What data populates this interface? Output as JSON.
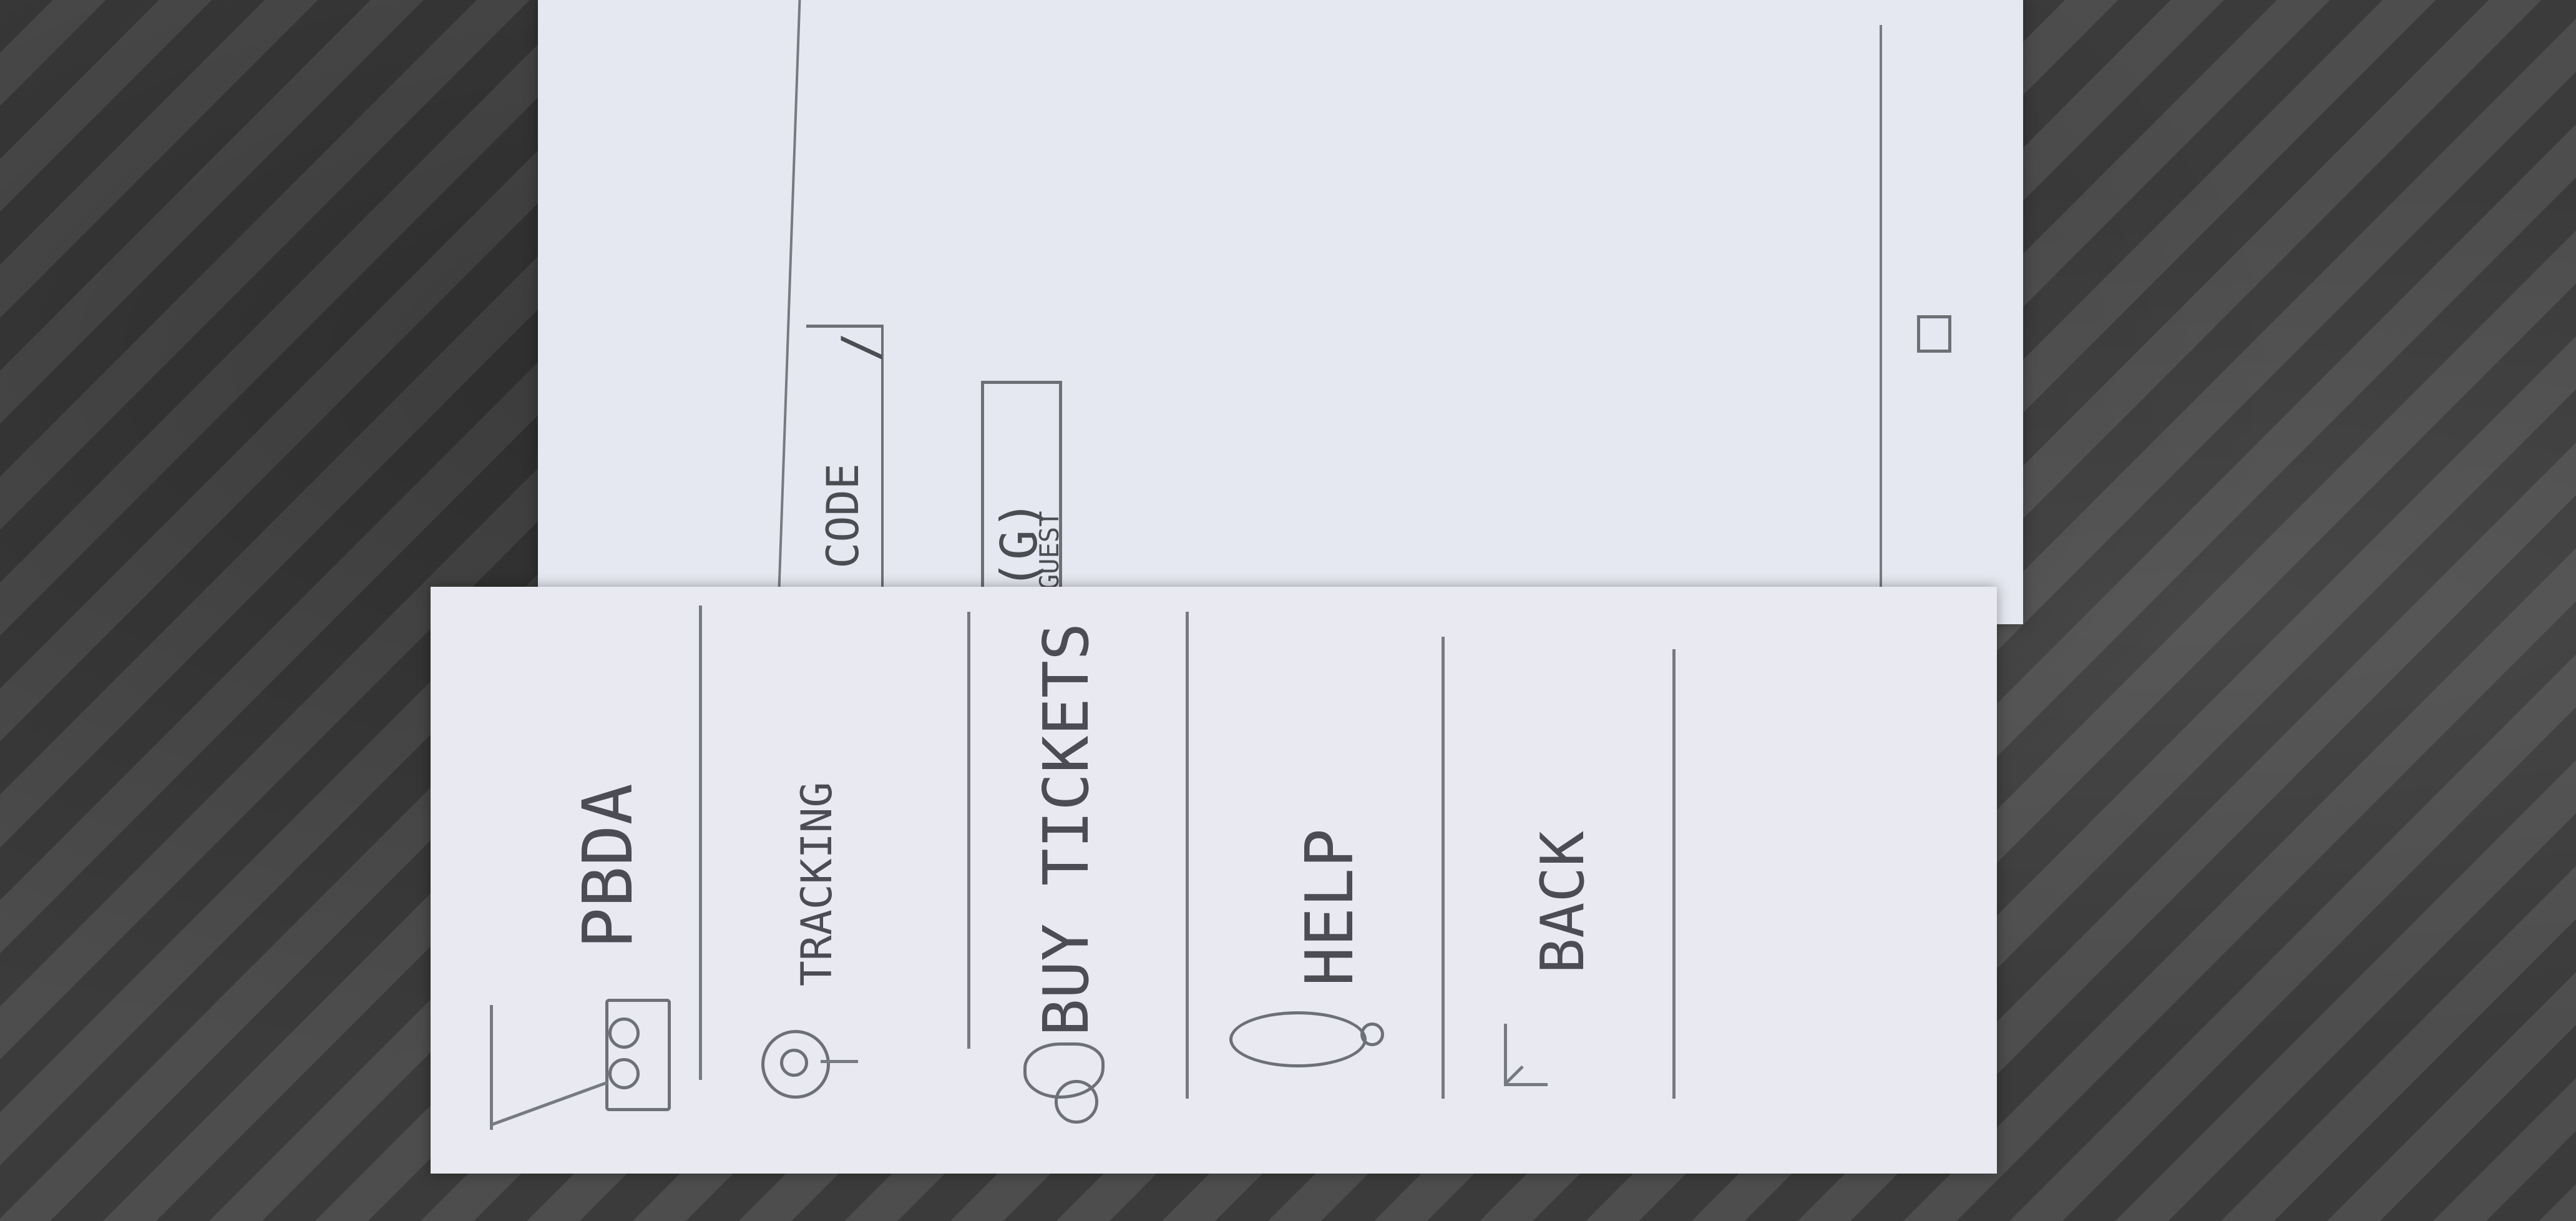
{
  "sketch": {
    "back_sheet": {
      "qr_label": "QR CODE",
      "qr_letter_fragment": "R CODE",
      "qr_extra": "/",
      "guest_count": "(G)",
      "guest_label": "GUEST"
    },
    "nav_bar": {
      "square_icon": "square-icon",
      "circle_icon": "circle-icon"
    },
    "menu": {
      "items": [
        {
          "label": "PBDA",
          "icon": "bus-stop-icon"
        },
        {
          "label": "TRACKING",
          "icon": "location-pin-icon"
        },
        {
          "label": "BUY TICKETS",
          "icon": "ticket-hand-icon"
        },
        {
          "label": "HELP",
          "icon": "lightbulb-icon"
        },
        {
          "label": "BACK",
          "icon": "back-arrow-icon"
        }
      ]
    }
  }
}
